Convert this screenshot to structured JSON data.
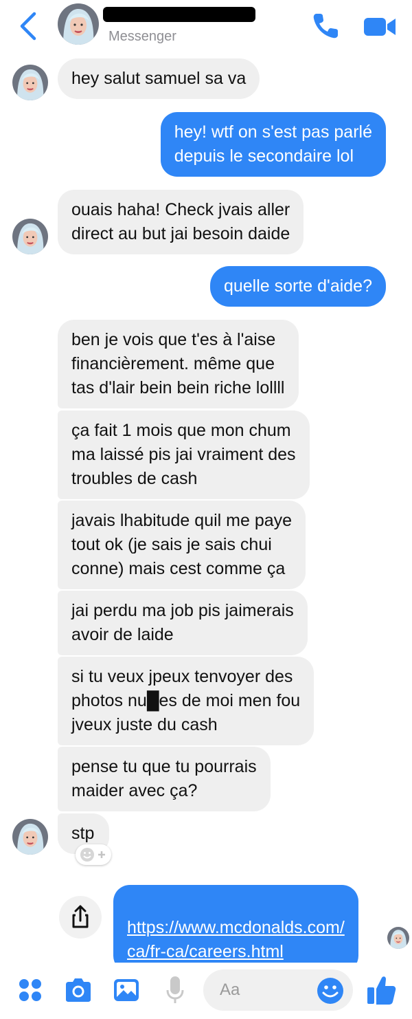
{
  "header": {
    "subtitle": "Messenger",
    "icons": [
      "back-chevron-icon",
      "phone-icon",
      "video-camera-icon"
    ],
    "accent_color": "#2f86f6"
  },
  "messages": [
    {
      "from": "them",
      "text": "hey salut samuel sa va"
    },
    {
      "from": "me",
      "text": "hey! wtf on s'est pas parlé\ndepuis le secondaire lol"
    },
    {
      "from": "them",
      "text": "ouais haha! Check jvais aller\ndirect au but jai besoin daide"
    },
    {
      "from": "me",
      "text": "quelle sorte d'aide?"
    },
    {
      "from": "them",
      "text": "ben je vois que t'es à l'aise\nfinancièrement. même que\ntas d'lair bein bein riche lollll"
    },
    {
      "from": "them",
      "text": "ça fait 1 mois que mon chum\nma laissé pis jai vraiment des\ntroubles de cash"
    },
    {
      "from": "them",
      "text": "javais lhabitude quil me paye\ntout ok (je sais je sais chui\nconne) mais cest comme ça"
    },
    {
      "from": "them",
      "text": "jai perdu ma job pis jaimerais\navoir de laide"
    },
    {
      "from": "them",
      "text": "si tu veux jpeux tenvoyer des\nphotos nu█es de moi men fou\njveux juste du cash"
    },
    {
      "from": "them",
      "text": "pense tu que tu pourrais\nmaider avec ça?"
    },
    {
      "from": "them",
      "text": "stp"
    },
    {
      "from": "me",
      "text": "https://www.mcdonalds.com/\nca/fr-ca/careers.html",
      "is_link": true
    }
  ],
  "composer": {
    "placeholder": "Aa",
    "icons": [
      "apps-dots-icon",
      "camera-icon",
      "gallery-icon",
      "microphone-icon",
      "emoji-icon",
      "thumbs-up-icon"
    ]
  },
  "colors": {
    "incoming_bubble": "#efefef",
    "outgoing_bubble": "#2f86f6"
  }
}
